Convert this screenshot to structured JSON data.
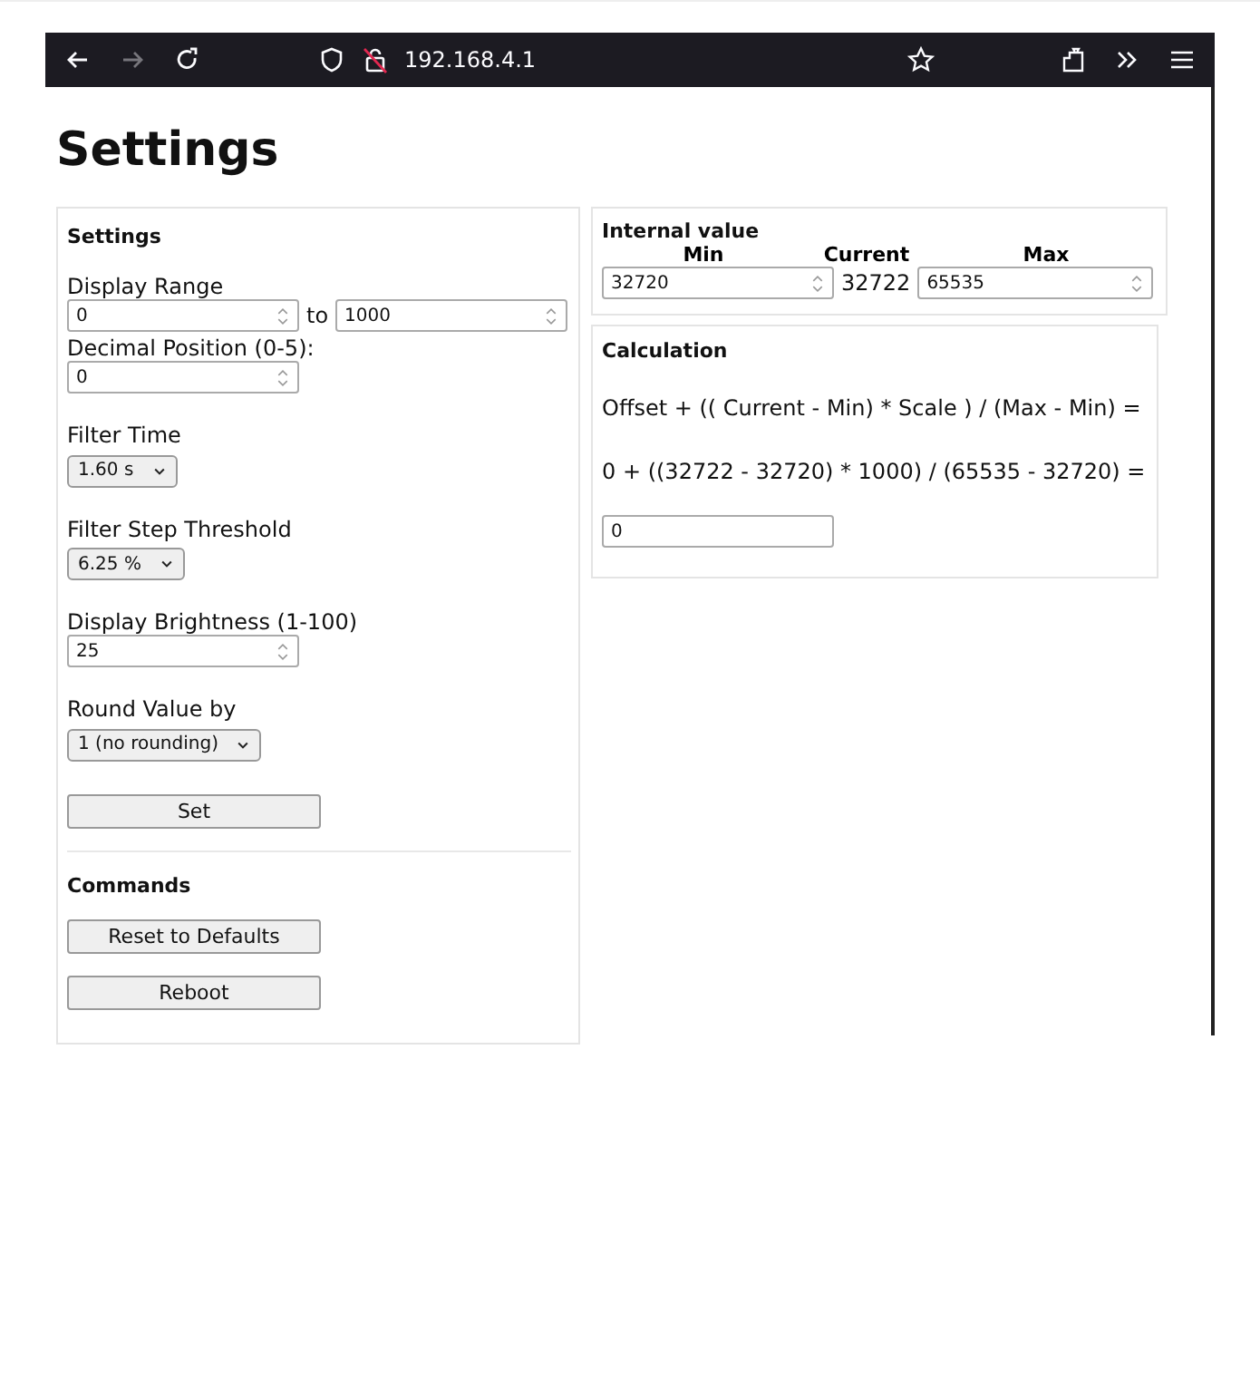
{
  "browser": {
    "url": "192.168.4.1"
  },
  "page_title": "Settings",
  "settings_panel": {
    "title": "Settings",
    "display_range": {
      "label": "Display Range",
      "from": "0",
      "separator": "to",
      "to": "1000"
    },
    "fields": [
      {
        "kind": "number",
        "label": "Decimal Position (0-5):",
        "value": "0"
      },
      {
        "kind": "select",
        "label": "Filter Time",
        "value": "1.60 s"
      },
      {
        "kind": "select",
        "label": "Filter Step Threshold",
        "value": "6.25 %"
      },
      {
        "kind": "number",
        "label": "Display Brightness (1-100)",
        "value": "25"
      },
      {
        "kind": "select",
        "label": "Round Value by",
        "value": "1 (no rounding)"
      }
    ],
    "set_button": "Set"
  },
  "commands_panel": {
    "title": "Commands",
    "buttons": [
      "Reset to Defaults",
      "Reboot"
    ]
  },
  "internal_value": {
    "title": "Internal value",
    "min_label": "Min",
    "current_label": "Current",
    "max_label": "Max",
    "min": "32720",
    "current": "32722",
    "max": "65535"
  },
  "calculation": {
    "title": "Calculation",
    "formula": "Offset + (( Current - Min) * Scale ) / (Max - Min) =",
    "substituted": "0 + ((32722 - 32720) * 1000) / (65535 - 32720) =",
    "result": "0"
  }
}
